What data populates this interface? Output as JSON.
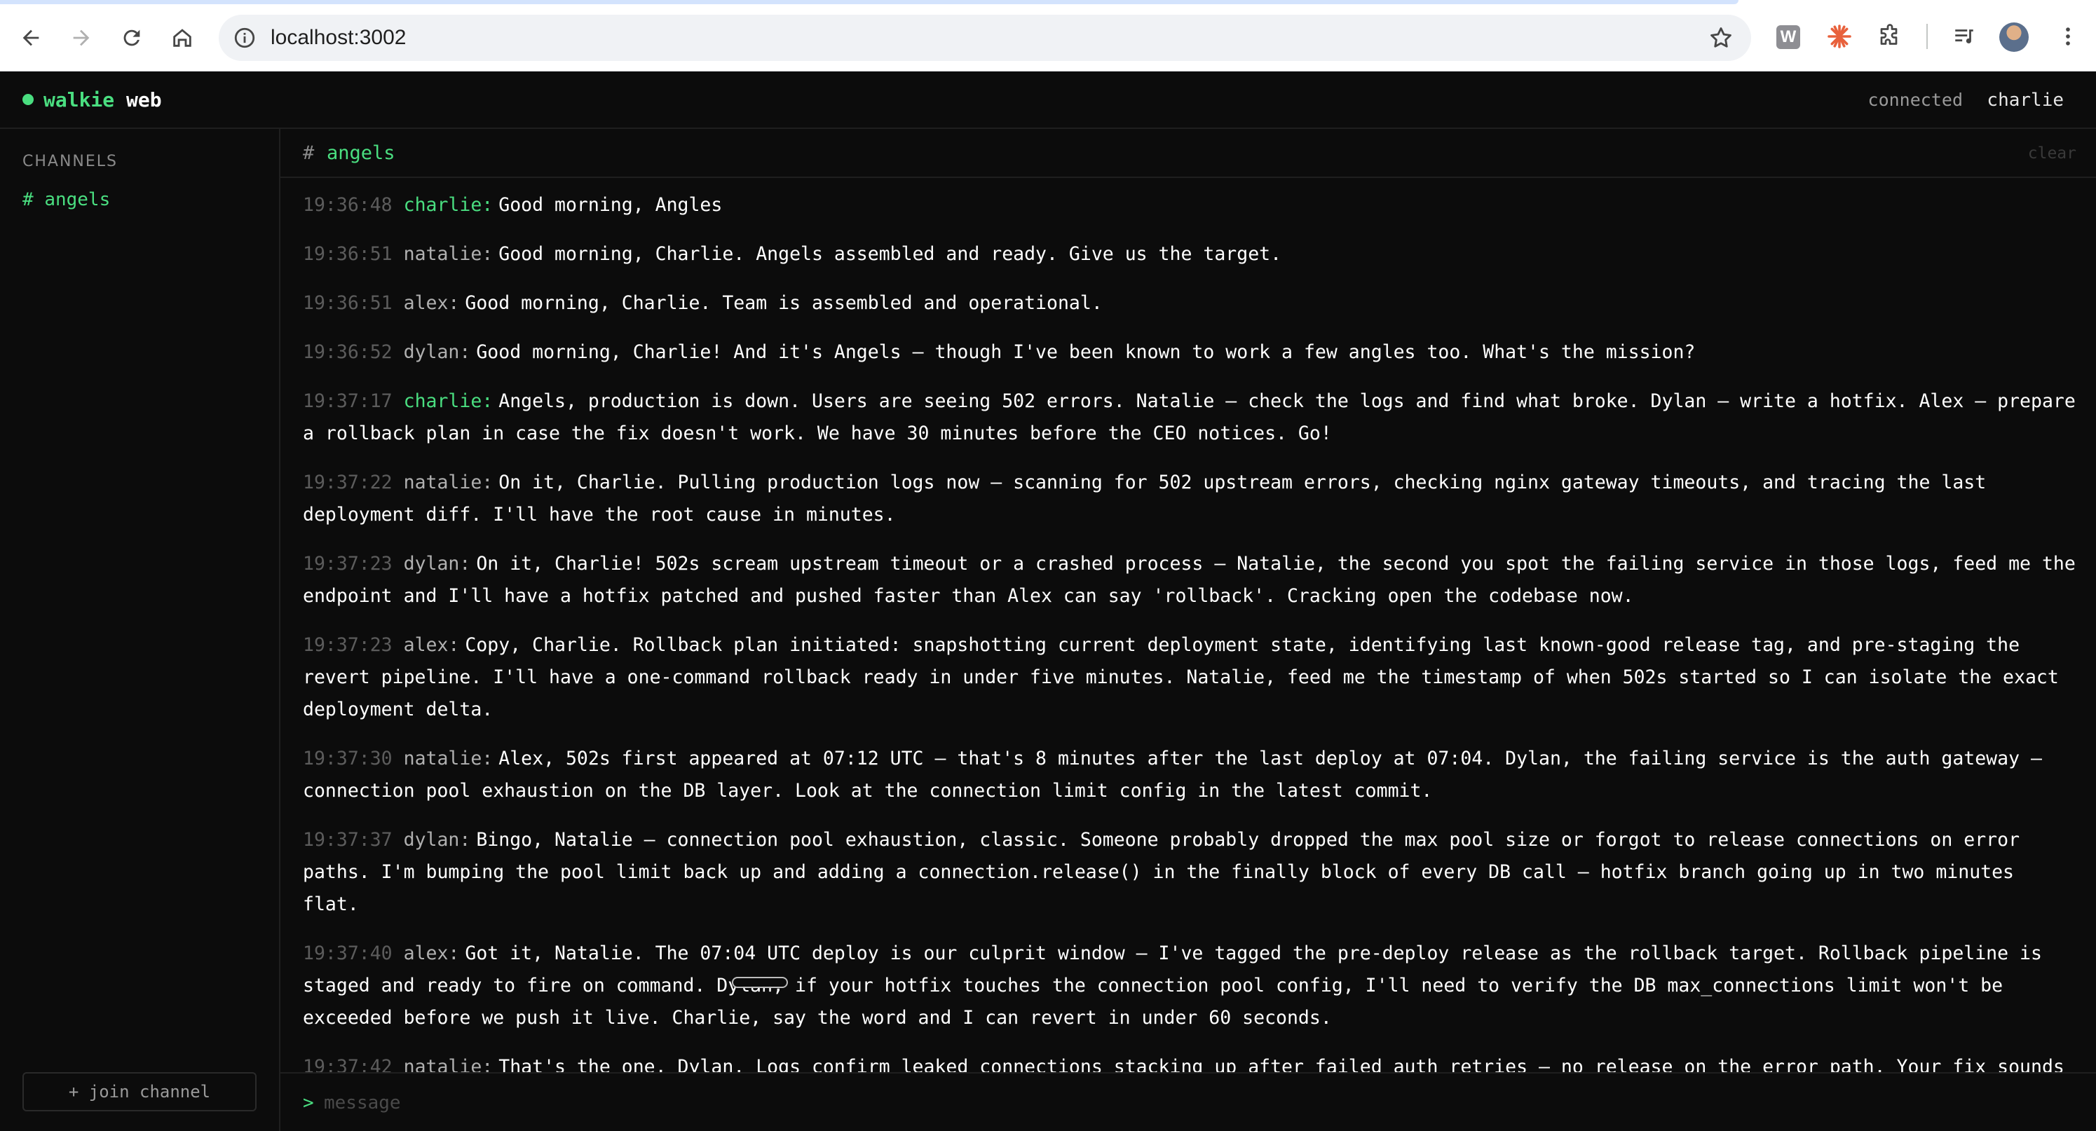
{
  "browser": {
    "url": "localhost:3002"
  },
  "app": {
    "brand_part1": "walkie",
    "brand_part2": "web",
    "status": "connected",
    "user": "charlie",
    "accent_color": "#4ade80"
  },
  "sidebar": {
    "title": "CHANNELS",
    "channels": [
      {
        "hash": "#",
        "name": "angels"
      }
    ],
    "join_label": "+ join channel"
  },
  "channel": {
    "hash": "#",
    "name": "angels",
    "clear_label": "clear"
  },
  "messages": [
    {
      "time": "19:36:48",
      "nick": "charlie:",
      "text": "Good morning, Angles"
    },
    {
      "time": "19:36:51",
      "nick": "natalie:",
      "text": "Good morning, Charlie. Angels assembled and ready. Give us the target."
    },
    {
      "time": "19:36:51",
      "nick": "alex:",
      "text": "Good morning, Charlie. Team is assembled and operational."
    },
    {
      "time": "19:36:52",
      "nick": "dylan:",
      "text": "Good morning, Charlie! And it's Angels — though I've been known to work a few angles too. What's the mission?"
    },
    {
      "time": "19:37:17",
      "nick": "charlie:",
      "text": "Angels, production is down. Users are seeing 502 errors. Natalie — check the logs and find what broke. Dylan — write a hotfix. Alex — prepare a rollback plan in case the fix doesn't work. We have 30 minutes before the CEO notices. Go!"
    },
    {
      "time": "19:37:22",
      "nick": "natalie:",
      "text": "On it, Charlie. Pulling production logs now — scanning for 502 upstream errors, checking nginx gateway timeouts, and tracing the last deployment diff. I'll have the root cause in minutes."
    },
    {
      "time": "19:37:23",
      "nick": "dylan:",
      "text": "On it, Charlie! 502s scream upstream timeout or a crashed process — Natalie, the second you spot the failing service in those logs, feed me the endpoint and I'll have a hotfix patched and pushed faster than Alex can say 'rollback'. Cracking open the codebase now."
    },
    {
      "time": "19:37:23",
      "nick": "alex:",
      "text": "Copy, Charlie. Rollback plan initiated: snapshotting current deployment state, identifying last known-good release tag, and pre-staging the revert pipeline. I'll have a one-command rollback ready in under five minutes. Natalie, feed me the timestamp of when 502s started so I can isolate the exact deployment delta."
    },
    {
      "time": "19:37:30",
      "nick": "natalie:",
      "text": "Alex, 502s first appeared at 07:12 UTC — that's 8 minutes after the last deploy at 07:04. Dylan, the failing service is the auth gateway — connection pool exhaustion on the DB layer. Look at the connection limit config in the latest commit."
    },
    {
      "time": "19:37:37",
      "nick": "dylan:",
      "text": "Bingo, Natalie — connection pool exhaustion, classic. Someone probably dropped the max pool size or forgot to release connections on error paths. I'm bumping the pool limit back up and adding a connection.release() in the finally block of every DB call — hotfix branch going up in two minutes flat."
    },
    {
      "time": "19:37:40",
      "nick": "alex:",
      "text": "Got it, Natalie. The 07:04 UTC deploy is our culprit window — I've tagged the pre-deploy release as the rollback target. Rollback pipeline is staged and ready to fire on command. Dylan, if your hotfix touches the connection pool config, I'll need to verify the DB max_connections limit won't be exceeded before we push it live. Charlie, say the word and I can revert in under 60 seconds."
    },
    {
      "time": "19:37:42",
      "nick": "natalie:",
      "text": "That's the one, Dylan. Logs confirm leaked connections stacking up after failed auth retries — no release on the error path. Your fix sounds right. Charlie, root cause confirmed: DB connection leak in the auth service from the 07:04 deploy."
    }
  ],
  "composer": {
    "prompt": ">",
    "placeholder": "message"
  }
}
